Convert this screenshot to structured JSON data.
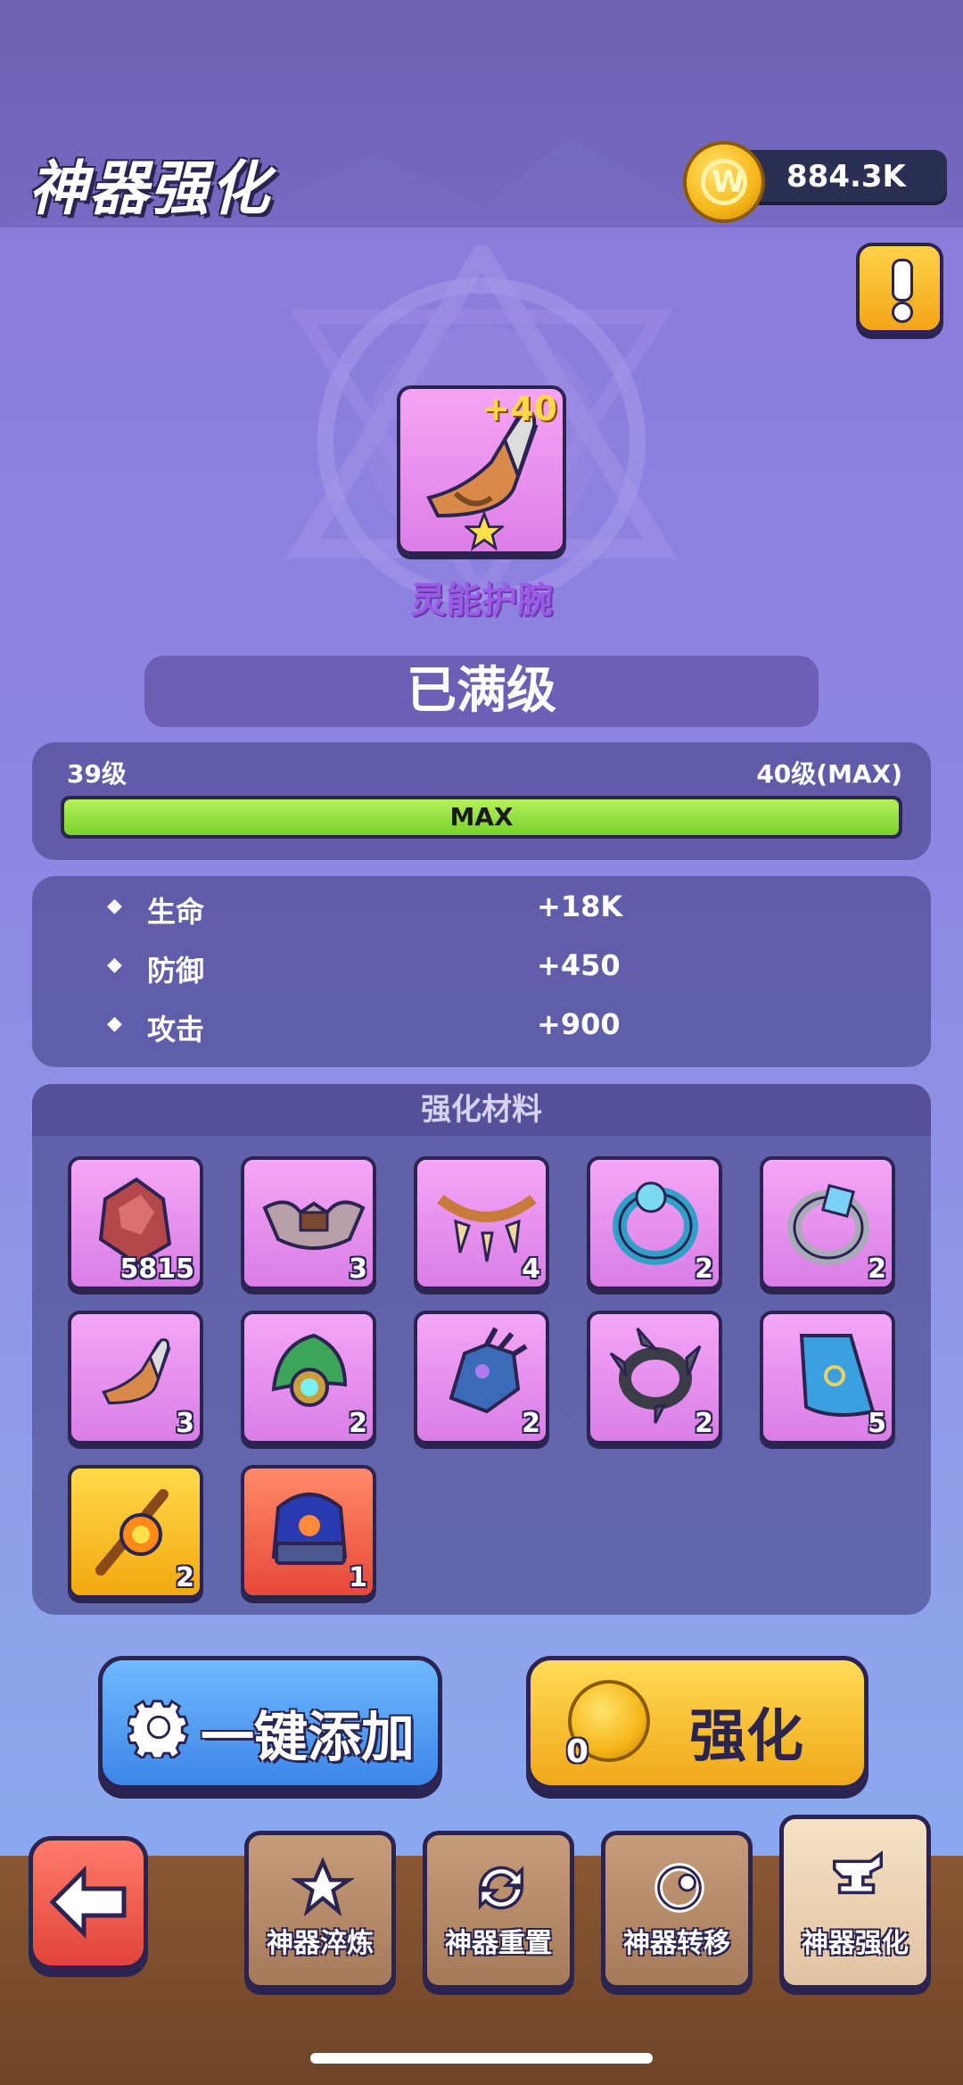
{
  "header": {
    "title": "神器强化",
    "currency_amount": "884.3K",
    "currency_icon": "gold-coin-icon"
  },
  "item": {
    "name": "灵能护腕",
    "enhance_level": "+40",
    "rarity_star": "star-icon"
  },
  "status_banner": "已满级",
  "level": {
    "current": "39级",
    "next": "40级(MAX)",
    "bar_label": "MAX",
    "progress": 1.0
  },
  "stats": [
    {
      "name": "生命",
      "value": "+18K"
    },
    {
      "name": "防御",
      "value": "+450"
    },
    {
      "name": "攻击",
      "value": "+900"
    }
  ],
  "materials": {
    "title": "强化材料",
    "items": [
      {
        "icon": "red-ore-icon",
        "count": "5815",
        "bg": "purple"
      },
      {
        "icon": "feather-collar-icon",
        "count": "3",
        "bg": "purple"
      },
      {
        "icon": "tooth-necklace-icon",
        "count": "4",
        "bg": "purple"
      },
      {
        "icon": "blue-ring-icon",
        "count": "2",
        "bg": "purple"
      },
      {
        "icon": "silver-ring-icon",
        "count": "2",
        "bg": "purple"
      },
      {
        "icon": "bracer-icon",
        "count": "3",
        "bg": "purple"
      },
      {
        "icon": "leaf-amulet-icon",
        "count": "2",
        "bg": "purple"
      },
      {
        "icon": "claw-gauntlet-icon",
        "count": "2",
        "bg": "purple"
      },
      {
        "icon": "spiked-ring-icon",
        "count": "2",
        "bg": "purple"
      },
      {
        "icon": "blue-cape-icon",
        "count": "5",
        "bg": "purple"
      },
      {
        "icon": "fire-staff-icon",
        "count": "2",
        "bg": "gold"
      },
      {
        "icon": "spirit-book-icon",
        "count": "1",
        "bg": "red"
      }
    ]
  },
  "buttons": {
    "auto_add": "一键添加",
    "enhance": "强化",
    "enhance_cost": "0"
  },
  "tabs": [
    {
      "label": "神器淬炼",
      "icon": "star-hammer-icon"
    },
    {
      "label": "神器重置",
      "icon": "reset-icon"
    },
    {
      "label": "神器转移",
      "icon": "transfer-icon"
    },
    {
      "label": "神器强化",
      "icon": "anvil-icon",
      "active": true
    }
  ],
  "back_button": {
    "icon": "arrow-left-icon"
  }
}
